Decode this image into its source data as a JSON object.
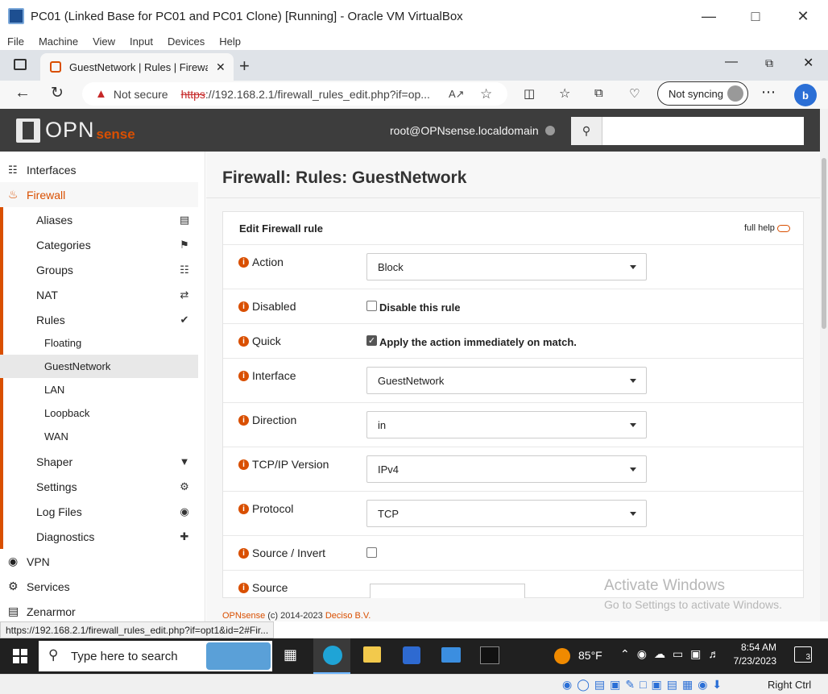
{
  "vbox": {
    "title": "PC01 (Linked Base for PC01 and PC01 Clone) [Running] - Oracle VM VirtualBox",
    "menu": [
      "File",
      "Machine",
      "View",
      "Input",
      "Devices",
      "Help"
    ],
    "host_key": "Right Ctrl"
  },
  "browser": {
    "tab_title": "GuestNetwork | Rules | Firewall | O",
    "not_secure": "Not secure",
    "url_scheme": "https",
    "url_rest": "://192.168.2.1/firewall_rules_edit.php?if=op...",
    "sync": "Not syncing",
    "status_url": "https://192.168.2.1/firewall_rules_edit.php?if=opt1&id=2#Fir..."
  },
  "header": {
    "brand_main": "OPN",
    "brand_sub": "sense",
    "user": "root@OPNsense.localdomain",
    "search_value": ""
  },
  "sidebar": {
    "top": [
      {
        "label": "Interfaces",
        "icon": "sitemap-icon"
      },
      {
        "label": "Firewall",
        "icon": "fire-icon"
      }
    ],
    "firewall_items": [
      {
        "label": "Aliases",
        "icon": "list-icon"
      },
      {
        "label": "Categories",
        "icon": "tags-icon"
      },
      {
        "label": "Groups",
        "icon": "sitemap-icon"
      },
      {
        "label": "NAT",
        "icon": "exchange-icon"
      },
      {
        "label": "Rules",
        "icon": "check-icon"
      }
    ],
    "rules_items": [
      "Floating",
      "GuestNetwork",
      "LAN",
      "Loopback",
      "WAN"
    ],
    "firewall_items_2": [
      {
        "label": "Shaper",
        "icon": "filter-icon"
      },
      {
        "label": "Settings",
        "icon": "cogs-icon"
      },
      {
        "label": "Log Files",
        "icon": "eye-icon"
      },
      {
        "label": "Diagnostics",
        "icon": "medkit-icon"
      }
    ],
    "bottom": [
      {
        "label": "VPN",
        "icon": "globe-icon"
      },
      {
        "label": "Services",
        "icon": "cog-icon"
      },
      {
        "label": "Zenarmor",
        "icon": "book-icon"
      }
    ]
  },
  "main": {
    "page_title": "Firewall: Rules: GuestNetwork",
    "card_title": "Edit Firewall rule",
    "full_help": "full help",
    "fields": {
      "action": {
        "label": "Action",
        "value": "Block"
      },
      "disabled": {
        "label": "Disabled",
        "checkbox_label": "Disable this rule",
        "checked": false
      },
      "quick": {
        "label": "Quick",
        "checkbox_label": "Apply the action immediately on match.",
        "checked": true
      },
      "interface": {
        "label": "Interface",
        "value": "GuestNetwork"
      },
      "direction": {
        "label": "Direction",
        "value": "in"
      },
      "ipversion": {
        "label": "TCP/IP Version",
        "value": "IPv4"
      },
      "protocol": {
        "label": "Protocol",
        "value": "TCP"
      },
      "source_invert": {
        "label": "Source / Invert",
        "checked": false
      },
      "source": {
        "label": "Source"
      }
    },
    "footer_brand": "OPNsense",
    "footer_text": "(c) 2014-2023",
    "footer_company": "Deciso B.V.",
    "watermark_title": "Activate Windows",
    "watermark_sub": "Go to Settings to activate Windows."
  },
  "taskbar": {
    "search_placeholder": "Type here to search",
    "temp": "85°F",
    "time": "8:54 AM",
    "date": "7/23/2023",
    "notif_count": "3"
  }
}
